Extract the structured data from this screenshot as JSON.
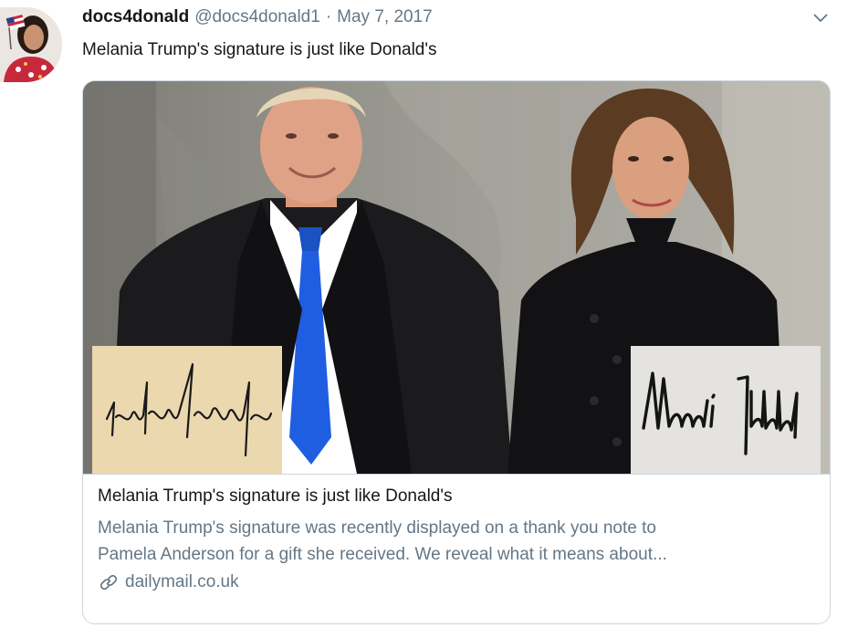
{
  "tweet": {
    "display_name": "docs4donald",
    "handle": "@docs4donald1",
    "separator": "·",
    "date": "May 7, 2017",
    "text": "Melania Trump's signature is just like Donald's"
  },
  "card": {
    "title": "Melania Trump's signature is just like Donald's",
    "description_line1": "Melania Trump's signature was recently displayed on a thank you note to",
    "description_line2": "Pamela Anderson for a gift she received. We reveal what it means about...",
    "domain": "dailymail.co.uk"
  },
  "icons": {
    "menu": "chevron-down-icon",
    "link": "link-icon"
  },
  "colors": {
    "text_primary": "#14171a",
    "text_secondary": "#657786",
    "border": "#ccd6dd",
    "tie_blue": "#1f5ee0"
  }
}
